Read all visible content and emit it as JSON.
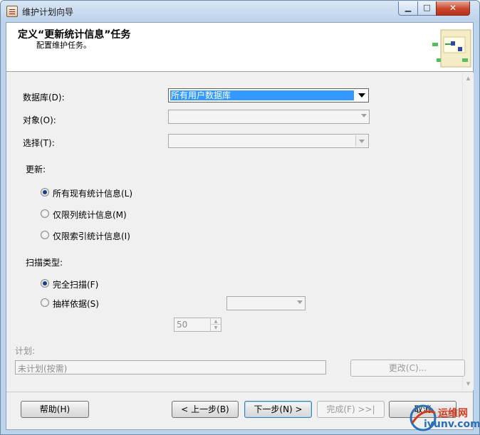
{
  "window": {
    "title": "维护计划向导",
    "caption_min": "▁",
    "caption_max": "□",
    "caption_close": "✕"
  },
  "header": {
    "title": "定义“更新统计信息”任务",
    "subtitle": "配置维护任务。"
  },
  "form": {
    "database_label": "数据库(D):",
    "database_value": "所有用户数据库",
    "object_label": "对象(O):",
    "select_label": "选择(T):",
    "update_label": "更新:",
    "update_options": [
      {
        "label": "所有现有统计信息(L)",
        "checked": true
      },
      {
        "label": "仅限列统计信息(M)",
        "checked": false
      },
      {
        "label": "仅限索引统计信息(I)",
        "checked": false
      }
    ],
    "scan_label": "扫描类型:",
    "scan_options": [
      {
        "label": "完全扫描(F)",
        "checked": true
      },
      {
        "label": "抽样依据(S)",
        "checked": false
      }
    ],
    "sample_value": "50",
    "schedule_label": "计划:",
    "schedule_value": "未计划(按需)",
    "change_button": "更改(C)..."
  },
  "footer": {
    "help": "帮助(H)",
    "back": "< 上一步(B)",
    "next": "下一步(N) >",
    "finish": "完成(F) >>|",
    "cancel": "取消"
  },
  "watermark": {
    "line1": "运维网",
    "line2": "iyunv.com"
  },
  "colors": {
    "selection": "#3399ff",
    "radio_dot": "#1d3d86",
    "close_button": "#c9462c"
  }
}
